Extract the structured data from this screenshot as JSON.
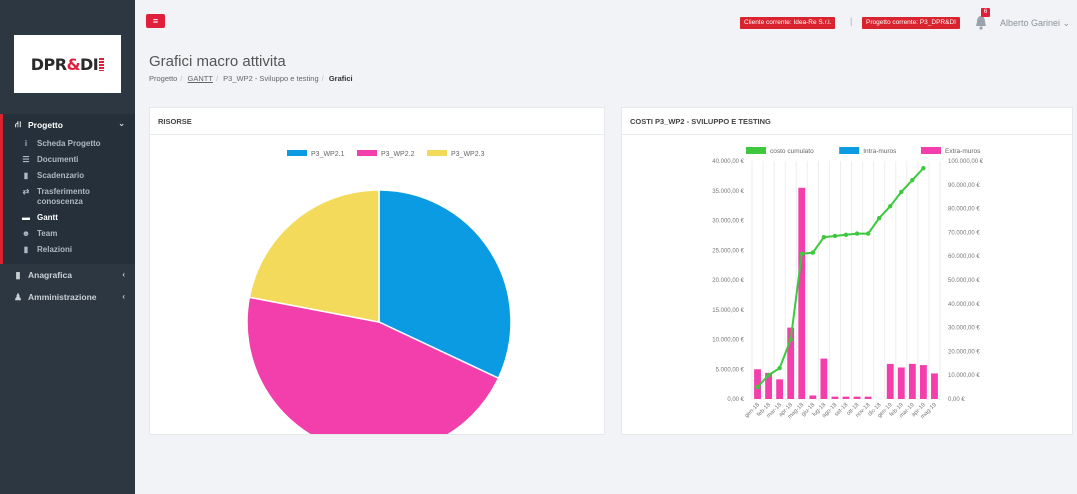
{
  "sidebar": {
    "logo": {
      "text_main": "DPR",
      "text_amp": "&",
      "text_end": "DI"
    },
    "sections": {
      "progetto": {
        "label": "Progetto",
        "items": [
          {
            "label": "Scheda Progetto",
            "icon": "info-icon"
          },
          {
            "label": "Documenti",
            "icon": "list-icon"
          },
          {
            "label": "Scadenzario",
            "icon": "file-icon"
          },
          {
            "label": "Trasferimento conoscenza",
            "icon": "exchange-icon"
          },
          {
            "label": "Gantt",
            "icon": "calendar-icon"
          },
          {
            "label": "Team",
            "icon": "users-icon"
          },
          {
            "label": "Relazioni",
            "icon": "file-icon"
          }
        ]
      },
      "anagrafica": {
        "label": "Anagrafica"
      },
      "amministrazione": {
        "label": "Amministrazione"
      }
    }
  },
  "topbar": {
    "client_badge": "Cliente corrente: Idea-Re S.r.l.",
    "separator": "|",
    "project_badge": "Progetto corrente: P3_DPR&DI",
    "notifications_count": "6",
    "user_name": "Alberto Garinei",
    "colors": {
      "accent": "#e0203a"
    }
  },
  "page": {
    "title": "Grafici macro attivita",
    "breadcrumb": [
      "Progetto",
      "GANTT",
      "P3_WP2 - Sviluppo e testing",
      "Grafici"
    ]
  },
  "panels": {
    "risorse": {
      "title": "RISORSE"
    },
    "costi": {
      "title": "COSTI P3_WP2 - SVILUPPO E TESTING"
    }
  },
  "chart_data": [
    {
      "type": "pie",
      "legend_position": "top",
      "series": [
        {
          "name": "P3_WP2.1",
          "value": 32,
          "color": "#0b9be3"
        },
        {
          "name": "P3_WP2.2",
          "value": 46,
          "color": "#f33fac"
        },
        {
          "name": "P3_WP2.3",
          "value": 22,
          "color": "#f4da5a"
        }
      ]
    },
    {
      "type": "bar",
      "legend_position": "top",
      "categories": [
        "gen-18",
        "feb-18",
        "mar-18",
        "apr-18",
        "mag-18",
        "giu-18",
        "lug-18",
        "ago-18",
        "set-18",
        "ott-18",
        "nov-18",
        "dic-18",
        "gen-19",
        "feb-19",
        "mar-19",
        "apr-19",
        "mag-19"
      ],
      "y_left": {
        "min": 0,
        "max": 40000,
        "ticks": [
          "0,00 €",
          "5.000,00 €",
          "10.000,00 €",
          "15.000,00 €",
          "20.000,00 €",
          "25.000,00 €",
          "30.000,00 €",
          "35.000,00 €",
          "40.000,00 €"
        ]
      },
      "y_right": {
        "min": 0,
        "max": 100000,
        "ticks": [
          "0,00 €",
          "10.000,00 €",
          "20.000,00 €",
          "30.000,00 €",
          "40.000,00 €",
          "50.000,00 €",
          "60.000,00 €",
          "70.000,00 €",
          "80.000,00 €",
          "90.000,00 €",
          "100.000,00 €"
        ]
      },
      "series": [
        {
          "name": "costo cumulato",
          "kind": "line",
          "axis": "right",
          "color": "#3ec83e",
          "values": [
            5000,
            10000,
            13000,
            25000,
            61000,
            61500,
            68000,
            68500,
            69000,
            69500,
            69500,
            76000,
            81000,
            87000,
            92000,
            97000
          ]
        },
        {
          "name": "Intra-muros",
          "kind": "bar",
          "axis": "left",
          "color": "#0b9be3",
          "values": [
            0,
            0,
            0,
            0,
            0,
            0,
            0,
            0,
            0,
            0,
            0,
            0,
            0,
            0,
            0,
            0,
            0
          ]
        },
        {
          "name": "Extra-muros",
          "kind": "bar",
          "axis": "left",
          "color": "#f33fac",
          "values": [
            5000,
            4400,
            3300,
            12000,
            35500,
            600,
            6800,
            400,
            400,
            400,
            400,
            0,
            5900,
            5300,
            5900,
            5700,
            4300
          ]
        }
      ]
    }
  ]
}
